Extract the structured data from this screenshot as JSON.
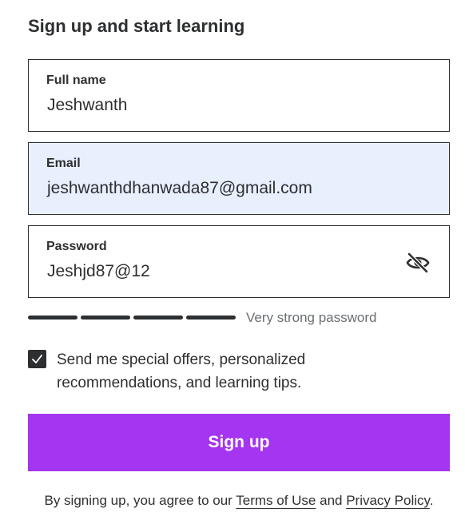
{
  "heading": "Sign up and start learning",
  "fields": {
    "full_name": {
      "label": "Full name",
      "value": "Jeshwanth"
    },
    "email": {
      "label": "Email",
      "value": "jeshwanthdhanwada87@gmail.com"
    },
    "password": {
      "label": "Password",
      "value": "Jeshjd87@12",
      "toggle_icon": "eye-slash-icon"
    }
  },
  "password_strength": {
    "label": "Very strong password",
    "filled_segments": 4,
    "total_segments": 4
  },
  "offers_checkbox": {
    "checked": true,
    "label": "Send me special offers, personalized recommendations, and learning tips."
  },
  "signup_button": {
    "label": "Sign up"
  },
  "legal": {
    "prefix": "By signing up, you agree to our ",
    "terms_link": "Terms of Use",
    "middle": " and ",
    "privacy_link": "Privacy Policy",
    "suffix": "."
  },
  "colors": {
    "primary": "#a435f0",
    "text": "#2d2f31",
    "focus_bg": "#e8effd",
    "muted": "#6a6f73"
  }
}
